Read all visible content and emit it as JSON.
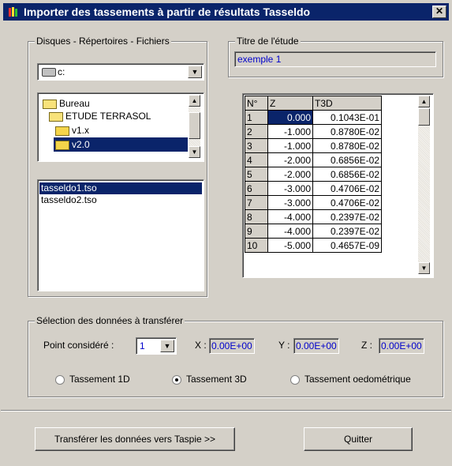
{
  "window": {
    "title": "Importer des tassements à partir de résultats Tasseldo",
    "close": "✕"
  },
  "files_group": {
    "legend": "Disques - Répertoires - Fichiers",
    "drive": "c:",
    "directories": [
      {
        "label": "Bureau",
        "icon": "open-folder-icon"
      },
      {
        "label": "ETUDE TERRASOL",
        "icon": "open-folder-icon"
      },
      {
        "label": "v1.x",
        "icon": "folder-icon"
      },
      {
        "label": "v2.0",
        "icon": "folder-icon"
      }
    ],
    "files": [
      "tasseldo1.tso",
      "tasseldo2.tso"
    ]
  },
  "study": {
    "legend": "Titre de l'étude",
    "value": "exemple 1"
  },
  "grid": {
    "headers": [
      "N°",
      "Z",
      "T3D"
    ],
    "rows": [
      [
        "1",
        "0.000",
        "0.1043E-01"
      ],
      [
        "2",
        "-1.000",
        "0.8780E-02"
      ],
      [
        "3",
        "-1.000",
        "0.8780E-02"
      ],
      [
        "4",
        "-2.000",
        "0.6856E-02"
      ],
      [
        "5",
        "-2.000",
        "0.6856E-02"
      ],
      [
        "6",
        "-3.000",
        "0.4706E-02"
      ],
      [
        "7",
        "-3.000",
        "0.4706E-02"
      ],
      [
        "8",
        "-4.000",
        "0.2397E-02"
      ],
      [
        "9",
        "-4.000",
        "0.2397E-02"
      ],
      [
        "10",
        "-5.000",
        "0.4657E-09"
      ]
    ]
  },
  "selection": {
    "legend": "Sélection des données à transférer",
    "point_label": "Point considéré :",
    "point_value": "1",
    "x_label": "X :",
    "x_value": "0.00E+00",
    "y_label": "Y :",
    "y_value": "0.00E+00",
    "z_label": "Z :",
    "z_value": "0.00E+00",
    "radios": [
      {
        "label": "Tassement 1D",
        "checked": false
      },
      {
        "label": "Tassement 3D",
        "checked": true
      },
      {
        "label": "Tassement oedométrique",
        "checked": false
      }
    ]
  },
  "buttons": {
    "transfer": "Transférer les données vers Taspie >>",
    "quit": "Quitter"
  },
  "colors": {
    "titlebar": "#0a246a",
    "selection": "#0a246a",
    "value_text": "#0000cc",
    "face": "#d4d0c8"
  }
}
